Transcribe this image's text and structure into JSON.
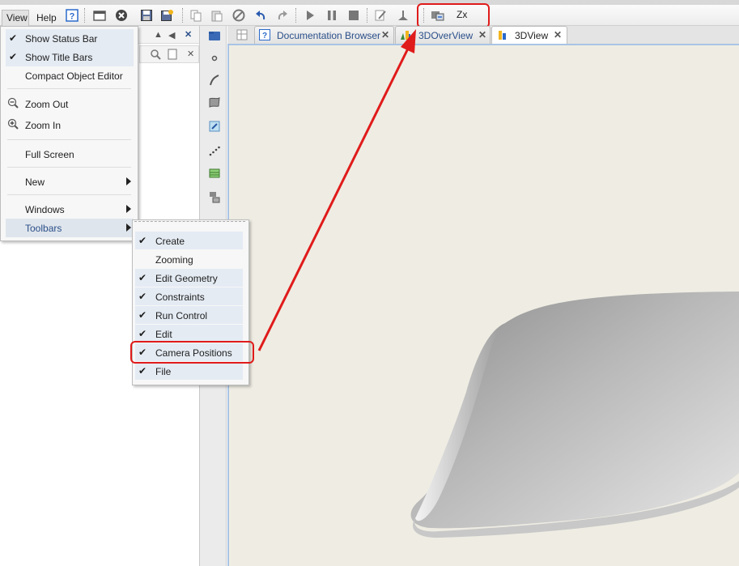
{
  "menubar": {
    "view_label": "View",
    "help_label": "Help"
  },
  "toolbar": {
    "icons": [
      "help-icon",
      "open-icon",
      "close-icon",
      "save-icon",
      "save-all-icon",
      "copy-icon",
      "paste-icon",
      "stop-sign-icon",
      "undo-icon",
      "redo-icon",
      "play-icon",
      "pause-icon",
      "stop-icon",
      "edit-icon",
      "camera-base-icon"
    ],
    "camera_positions": {
      "icon": "camera-positions-icon",
      "label": "Zx"
    }
  },
  "view_menu": {
    "items": [
      {
        "label": "Show Status Bar",
        "checked": true
      },
      {
        "label": "Show Title Bars",
        "checked": true
      },
      {
        "label": "Compact Object Editor",
        "checked": false
      },
      {
        "label": "Zoom Out",
        "icon": "zoom-out-icon"
      },
      {
        "label": "Zoom In",
        "icon": "zoom-in-icon"
      },
      {
        "label": "Full Screen"
      },
      {
        "label": "New",
        "submenu": true
      },
      {
        "label": "Windows",
        "submenu": true
      },
      {
        "label": "Toolbars",
        "submenu": true,
        "active": true
      }
    ]
  },
  "toolbars_submenu": {
    "items": [
      {
        "label": "Create",
        "checked": true
      },
      {
        "label": "Zooming",
        "checked": false
      },
      {
        "label": "Edit Geometry",
        "checked": true
      },
      {
        "label": "Constraints",
        "checked": true
      },
      {
        "label": "Run Control",
        "checked": true
      },
      {
        "label": "Edit",
        "checked": true
      },
      {
        "label": "Camera Positions",
        "checked": true,
        "highlighted": true
      },
      {
        "label": "File",
        "checked": true
      }
    ]
  },
  "tabs": [
    {
      "label": "Documentation Browser",
      "icon": "help-icon",
      "close": "✕"
    },
    {
      "label": "3DOverView",
      "icon": "chart-icon",
      "close": "✕"
    },
    {
      "label": "3DView",
      "icon": "chart-icon",
      "close": "✕",
      "active": true
    }
  ],
  "colors": {
    "highlight": "#e01b1b",
    "viewport_bg": "#efede3",
    "menu_checked_bg": "#e4ebf3",
    "tab_text": "#2a4f8a"
  }
}
